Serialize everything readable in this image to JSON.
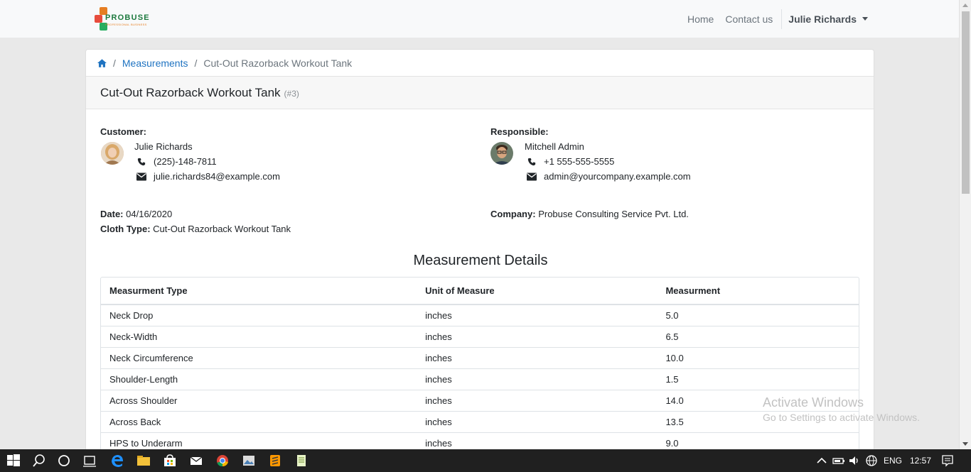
{
  "navbar": {
    "logo_text": "PROBUSE",
    "logo_tagline": "PROFESSIONAL BUSINESS",
    "links": [
      "Home",
      "Contact us"
    ],
    "user": "Julie Richards"
  },
  "breadcrumb": {
    "items": [
      "Measurements"
    ],
    "current": "Cut-Out Razorback Workout Tank"
  },
  "header": {
    "title": "Cut-Out Razorback Workout Tank",
    "ref": "(#3)"
  },
  "customer": {
    "label": "Customer:",
    "name": "Julie Richards",
    "phone": "(225)-148-7811",
    "email": "julie.richards84@example.com"
  },
  "responsible": {
    "label": "Responsible:",
    "name": "Mitchell Admin",
    "phone": "+1 555-555-5555",
    "email": "admin@yourcompany.example.com"
  },
  "details": {
    "date_label": "Date:",
    "date": "04/16/2020",
    "cloth_label": "Cloth Type:",
    "cloth": "Cut-Out Razorback Workout Tank",
    "company_label": "Company:",
    "company": "Probuse Consulting Service Pvt. Ltd."
  },
  "measurements": {
    "title": "Measurement Details",
    "columns": [
      "Measurment Type",
      "Unit of Measure",
      "Measurment"
    ],
    "rows": [
      [
        "Neck Drop",
        "inches",
        "5.0"
      ],
      [
        "Neck-Width",
        "inches",
        "6.5"
      ],
      [
        "Neck Circumference",
        "inches",
        "10.0"
      ],
      [
        "Shoulder-Length",
        "inches",
        "1.5"
      ],
      [
        "Across Shoulder",
        "inches",
        "14.0"
      ],
      [
        "Across Back",
        "inches",
        "13.5"
      ],
      [
        "HPS to Underarm",
        "inches",
        "9.0"
      ]
    ]
  },
  "watermark": {
    "line1": "Activate Windows",
    "line2": "Go to Settings to activate Windows."
  },
  "taskbar": {
    "language": "ENG",
    "time": "12:57"
  },
  "colors": {
    "link": "#1f73c1",
    "navbar_bg": "#f8f9fa",
    "page_bg": "#e9e9e9",
    "taskbar_bg": "#202020"
  }
}
